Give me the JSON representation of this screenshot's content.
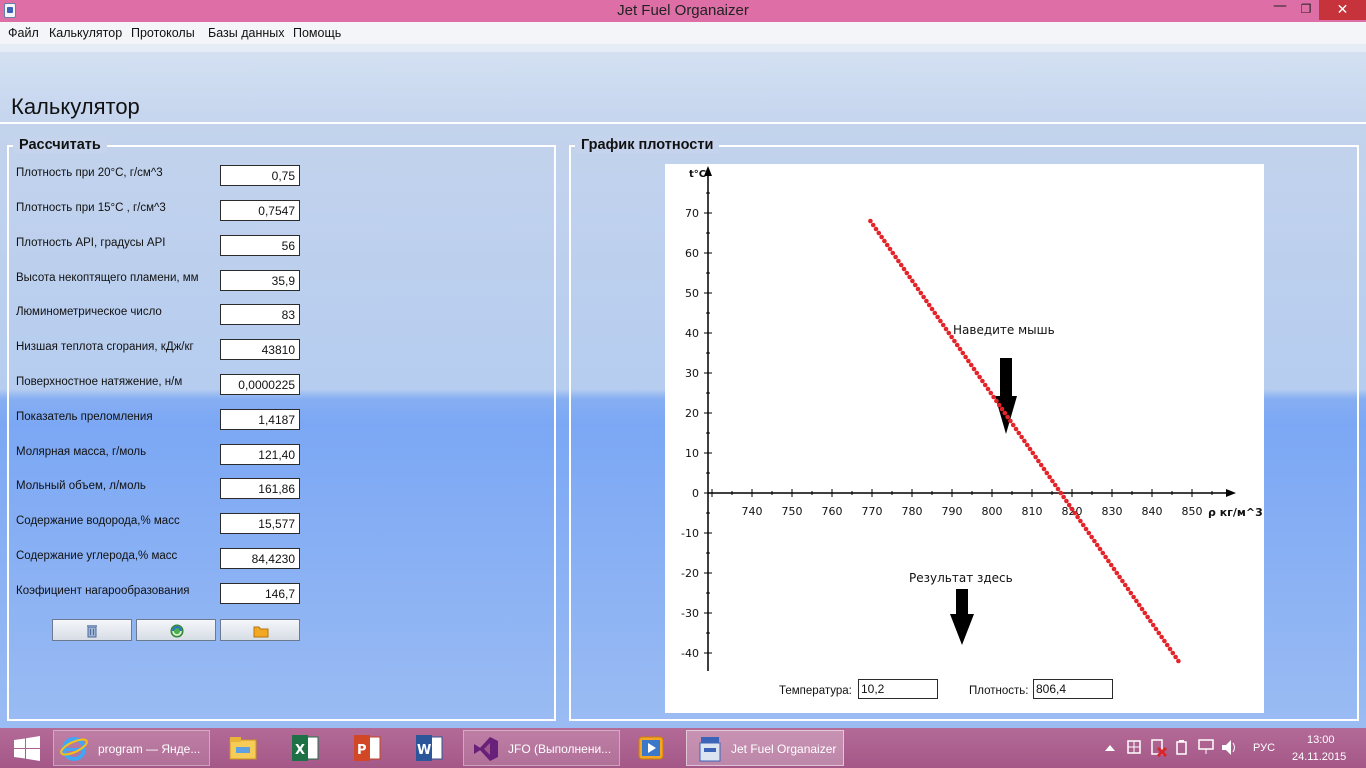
{
  "window": {
    "title": "Jet Fuel Organaizer",
    "minimize": "—",
    "maximize": "❐",
    "close": "✕"
  },
  "menu": [
    "Файл",
    "Калькулятор",
    "Протоколы",
    "Базы данных",
    "Помощь"
  ],
  "page_title": "Калькулятор",
  "calc": {
    "title": "Рассчитать",
    "rows": [
      {
        "label": "Плотность при 20°С, г/см^3",
        "value": "0,75"
      },
      {
        "label": "Плотность при 15°С , г/см^3",
        "value": "0,7547"
      },
      {
        "label": "Плотность API, градусы API",
        "value": "56"
      },
      {
        "label": "Высота некоптящего пламени, мм",
        "value": "35,9"
      },
      {
        "label": "Люминометрическое число",
        "value": "83"
      },
      {
        "label": "Низшая теплота сгорания, кДж/кг",
        "value": "43810"
      },
      {
        "label": "Поверхностное натяжение, н/м",
        "value": "0,0000225"
      },
      {
        "label": "Показатель преломления",
        "value": "1,4187"
      },
      {
        "label": "Молярная масса, г/моль",
        "value": "121,40"
      },
      {
        "label": "Мольный объем, л/моль",
        "value": "161,86"
      },
      {
        "label": "Содержание водорода,% масс",
        "value": "15,577"
      },
      {
        "label": "Содержание углерода,% масс",
        "value": "84,4230"
      },
      {
        "label": "Коэфициент нагарообразования",
        "value": "146,7"
      }
    ],
    "buttons": [
      {
        "name": "clear-button",
        "icon": "trash-icon"
      },
      {
        "name": "calculate-button",
        "icon": "refresh-icon"
      },
      {
        "name": "open-button",
        "icon": "folder-icon"
      }
    ]
  },
  "chart": {
    "title": "График плотности",
    "hover_hint": "Наведите мышь",
    "result_hint": "Результат здесь",
    "temperature_label": "Температура:",
    "temperature_value": "10,2",
    "density_label": "Плотность:",
    "density_value": "806,4"
  },
  "chart_data": {
    "type": "scatter",
    "title": "",
    "xlabel": "ρ кг/м^3",
    "ylabel": "t°C",
    "xlim": [
      729,
      858
    ],
    "ylim": [
      -43,
      77
    ],
    "x_ticks": [
      740,
      750,
      760,
      770,
      780,
      790,
      800,
      810,
      820,
      830,
      840,
      850
    ],
    "y_ticks": [
      -40,
      -30,
      -20,
      -10,
      0,
      10,
      20,
      30,
      40,
      50,
      60,
      70
    ],
    "point_color": "#e3242b",
    "grid": false,
    "series": [
      {
        "x_start": 769.6,
        "x_end": 846.6,
        "y_start": 68,
        "y_end": -42,
        "count": 111
      }
    ]
  },
  "taskbar": {
    "apps": [
      {
        "name": "ie-app",
        "label": "program — Янде..."
      },
      {
        "name": "explorer-app",
        "label": ""
      },
      {
        "name": "excel-app",
        "label": ""
      },
      {
        "name": "powerpoint-app",
        "label": ""
      },
      {
        "name": "word-app",
        "label": ""
      },
      {
        "name": "visual-studio-app",
        "label": "JFO (Выполнени..."
      },
      {
        "name": "media-app",
        "label": ""
      },
      {
        "name": "jet-fuel-app",
        "label": "Jet Fuel Organaizer"
      }
    ],
    "lang": "РУС",
    "time": "13:00",
    "date": "24.11.2015"
  },
  "colors": {
    "titlebar": "#dd6fa6",
    "taskbar": "#a35887",
    "close": "#c7333a",
    "points": "#e3242b"
  }
}
